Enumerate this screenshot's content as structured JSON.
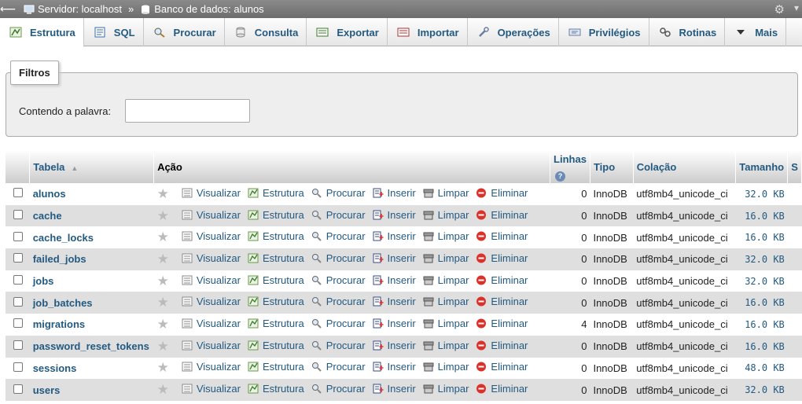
{
  "breadcrumb": {
    "server_label": "Servidor: localhost",
    "separator": "»",
    "database_label": "Banco de dados: alunos"
  },
  "tabs": [
    {
      "label": "Estrutura",
      "icon": "structure-icon",
      "active": true
    },
    {
      "label": "SQL",
      "icon": "sql-icon"
    },
    {
      "label": "Procurar",
      "icon": "search-icon"
    },
    {
      "label": "Consulta",
      "icon": "query-icon"
    },
    {
      "label": "Exportar",
      "icon": "export-icon"
    },
    {
      "label": "Importar",
      "icon": "import-icon"
    },
    {
      "label": "Operações",
      "icon": "wrench-icon"
    },
    {
      "label": "Privilégios",
      "icon": "privileges-icon"
    },
    {
      "label": "Rotinas",
      "icon": "routines-icon"
    },
    {
      "label": "Mais",
      "icon": "chevron-down-icon"
    }
  ],
  "filters": {
    "legend": "Filtros",
    "label": "Contendo a palavra:",
    "value": ""
  },
  "table": {
    "headers": {
      "table": "Tabela",
      "action": "Ação",
      "rows": "Linhas",
      "type": "Tipo",
      "collation": "Colação",
      "size": "Tamanho",
      "overhead": "S"
    },
    "actions": {
      "browse": "Visualizar",
      "structure": "Estrutura",
      "search": "Procurar",
      "insert": "Inserir",
      "empty": "Limpar",
      "drop": "Eliminar"
    },
    "rows": [
      {
        "name": "alunos",
        "rows": "0",
        "type": "InnoDB",
        "collation": "utf8mb4_unicode_ci",
        "size": "32.0 KB"
      },
      {
        "name": "cache",
        "rows": "0",
        "type": "InnoDB",
        "collation": "utf8mb4_unicode_ci",
        "size": "16.0 KB"
      },
      {
        "name": "cache_locks",
        "rows": "0",
        "type": "InnoDB",
        "collation": "utf8mb4_unicode_ci",
        "size": "16.0 KB"
      },
      {
        "name": "failed_jobs",
        "rows": "0",
        "type": "InnoDB",
        "collation": "utf8mb4_unicode_ci",
        "size": "32.0 KB"
      },
      {
        "name": "jobs",
        "rows": "0",
        "type": "InnoDB",
        "collation": "utf8mb4_unicode_ci",
        "size": "32.0 KB"
      },
      {
        "name": "job_batches",
        "rows": "0",
        "type": "InnoDB",
        "collation": "utf8mb4_unicode_ci",
        "size": "16.0 KB"
      },
      {
        "name": "migrations",
        "rows": "4",
        "type": "InnoDB",
        "collation": "utf8mb4_unicode_ci",
        "size": "16.0 KB"
      },
      {
        "name": "password_reset_tokens",
        "rows": "0",
        "type": "InnoDB",
        "collation": "utf8mb4_unicode_ci",
        "size": "16.0 KB"
      },
      {
        "name": "sessions",
        "rows": "0",
        "type": "InnoDB",
        "collation": "utf8mb4_unicode_ci",
        "size": "48.0 KB"
      },
      {
        "name": "users",
        "rows": "0",
        "type": "InnoDB",
        "collation": "utf8mb4_unicode_ci",
        "size": "32.0 KB"
      }
    ]
  },
  "colors": {
    "link": "#235a81",
    "drop_icon": "#d9322b",
    "breadcrumb_bg": "#7a7a7a"
  }
}
